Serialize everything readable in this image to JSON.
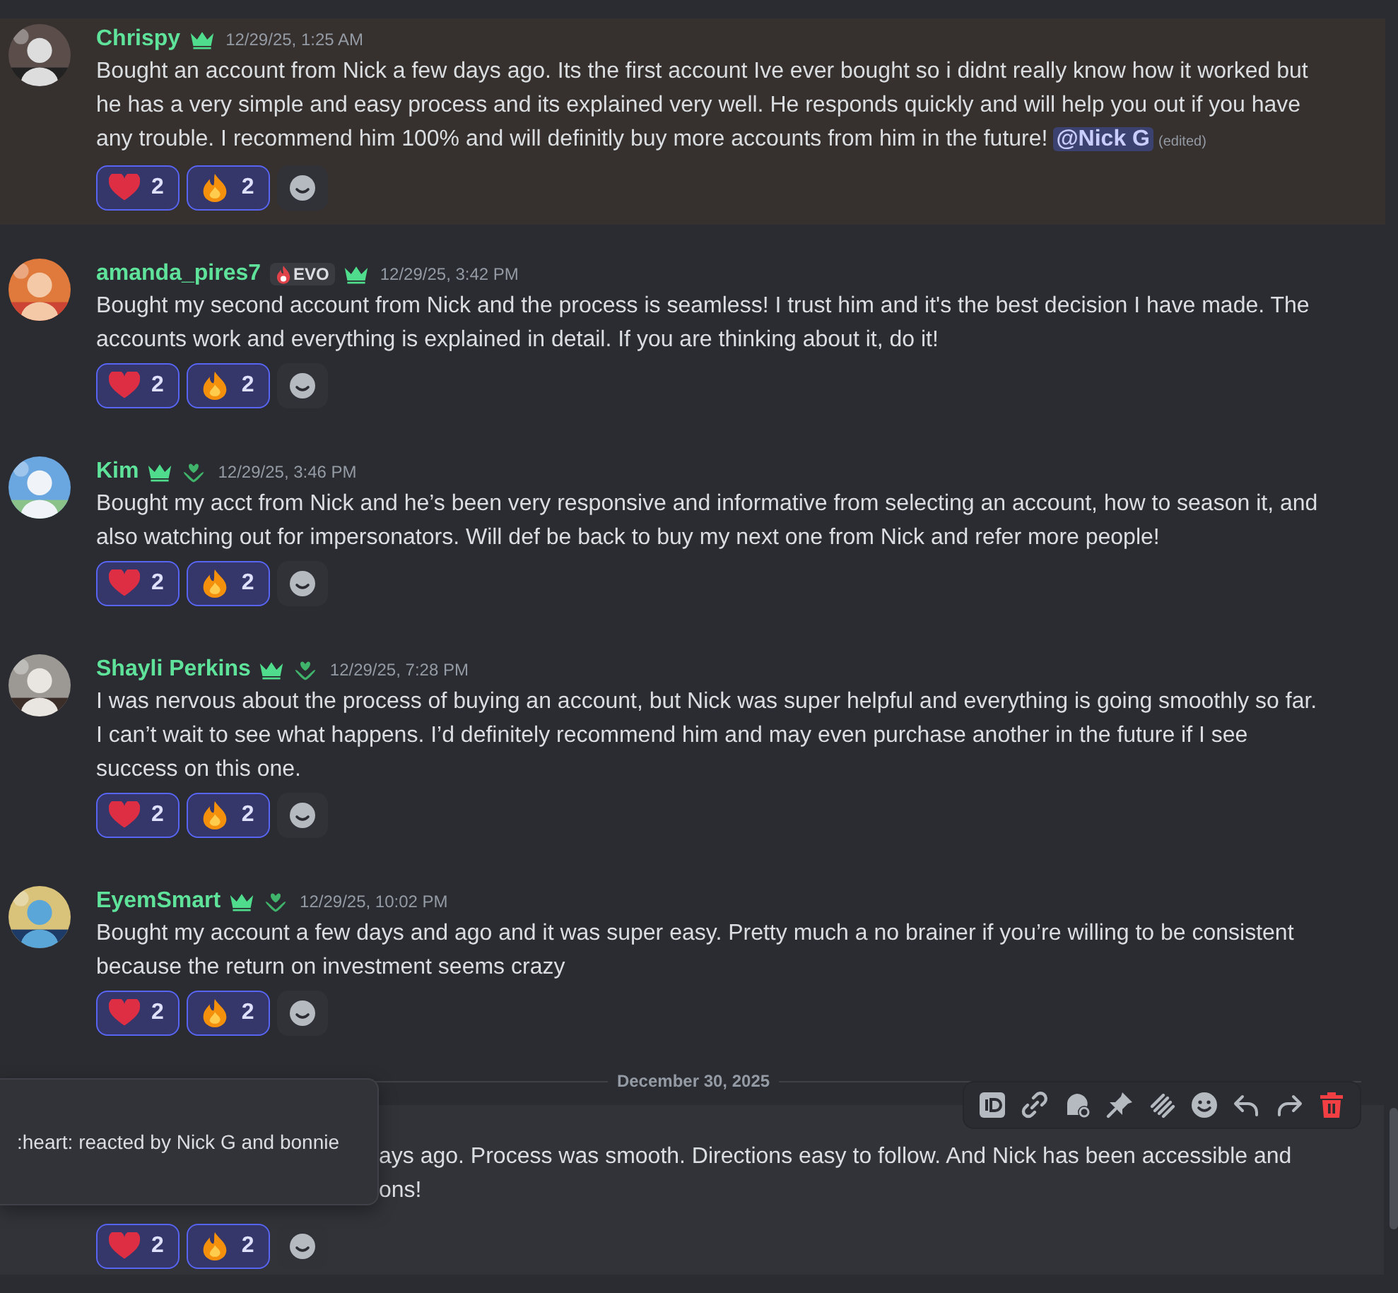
{
  "messages": [
    {
      "author": "Chrispy",
      "highlighted": true,
      "badges": [
        {
          "kind": "crown"
        }
      ],
      "time": "12/29/25, 1:25 AM",
      "text": "Bought an account from Nick a few days ago. Its the first account Ive ever bought so i didnt really know how it worked but he has a very simple and easy process and its explained very well. He responds quickly and will help you out if you have any trouble. I recommend him 100% and will definitly buy more accounts from him in the future!",
      "mention": "@Nick G",
      "edited": "(edited)",
      "reactions": [
        {
          "kind": "heart",
          "count": "2",
          "selected": true
        },
        {
          "kind": "fire",
          "count": "2",
          "selected": true
        }
      ]
    },
    {
      "author": "amanda_pires7",
      "highlighted": false,
      "badges": [
        {
          "kind": "tag",
          "label": "EVO"
        },
        {
          "kind": "crown"
        }
      ],
      "time": "12/29/25, 3:42 PM",
      "text": "Bought my second account from Nick and the process is seamless! I trust him and it's the best decision I have made. The accounts work and everything is explained in detail. If you are thinking about it, do it!",
      "reactions": [
        {
          "kind": "heart",
          "count": "2",
          "selected": true
        },
        {
          "kind": "fire",
          "count": "2",
          "selected": true
        }
      ]
    },
    {
      "author": "Kim",
      "highlighted": false,
      "badges": [
        {
          "kind": "crown"
        },
        {
          "kind": "hands"
        }
      ],
      "time": "12/29/25, 3:46 PM",
      "text": "Bought my acct from Nick and he’s been very responsive and informative from selecting an account, how to season it, and also watching out for impersonators. Will def be back to buy my next one from Nick and refer more people!",
      "reactions": [
        {
          "kind": "heart",
          "count": "2",
          "selected": true
        },
        {
          "kind": "fire",
          "count": "2",
          "selected": true
        }
      ]
    },
    {
      "author": "Shayli Perkins",
      "highlighted": false,
      "badges": [
        {
          "kind": "crown"
        },
        {
          "kind": "hands"
        }
      ],
      "time": "12/29/25, 7:28 PM",
      "text": "I was nervous about the process of buying an account, but Nick was super helpful and everything is going smoothly so far. I can’t wait to see what happens. I’d definitely recommend him and may even purchase another in the future if I see success on this one.",
      "reactions": [
        {
          "kind": "heart",
          "count": "2",
          "selected": true
        },
        {
          "kind": "fire",
          "count": "2",
          "selected": true
        }
      ]
    },
    {
      "author": "EyemSmart",
      "highlighted": false,
      "badges": [
        {
          "kind": "crown"
        },
        {
          "kind": "hands"
        }
      ],
      "time": "12/29/25, 10:02 PM",
      "text": "Bought my account a few days and ago and it was super easy. Pretty much a no brainer if you’re willing to be consistent because the return on investment seems crazy",
      "reactions": [
        {
          "kind": "heart",
          "count": "2",
          "selected": true
        },
        {
          "kind": "fire",
          "count": "2",
          "selected": true
        }
      ]
    }
  ],
  "divider": "December 30, 2025",
  "last_message": {
    "lines": [
      "ays ago. Process was smooth. Directions easy to follow. And Nick has been accessible and",
      "ons!"
    ],
    "reactions": [
      {
        "kind": "heart",
        "count": "2",
        "selected": true
      },
      {
        "kind": "fire",
        "count": "2",
        "selected": true
      }
    ]
  },
  "toolbar": [
    {
      "kind": "id"
    },
    {
      "kind": "link"
    },
    {
      "kind": "thread"
    },
    {
      "kind": "pin"
    },
    {
      "kind": "grip"
    },
    {
      "kind": "emoji"
    },
    {
      "kind": "reply"
    },
    {
      "kind": "forward"
    },
    {
      "kind": "delete"
    }
  ],
  "tooltip": ":heart: reacted by Nick G and bonnie"
}
